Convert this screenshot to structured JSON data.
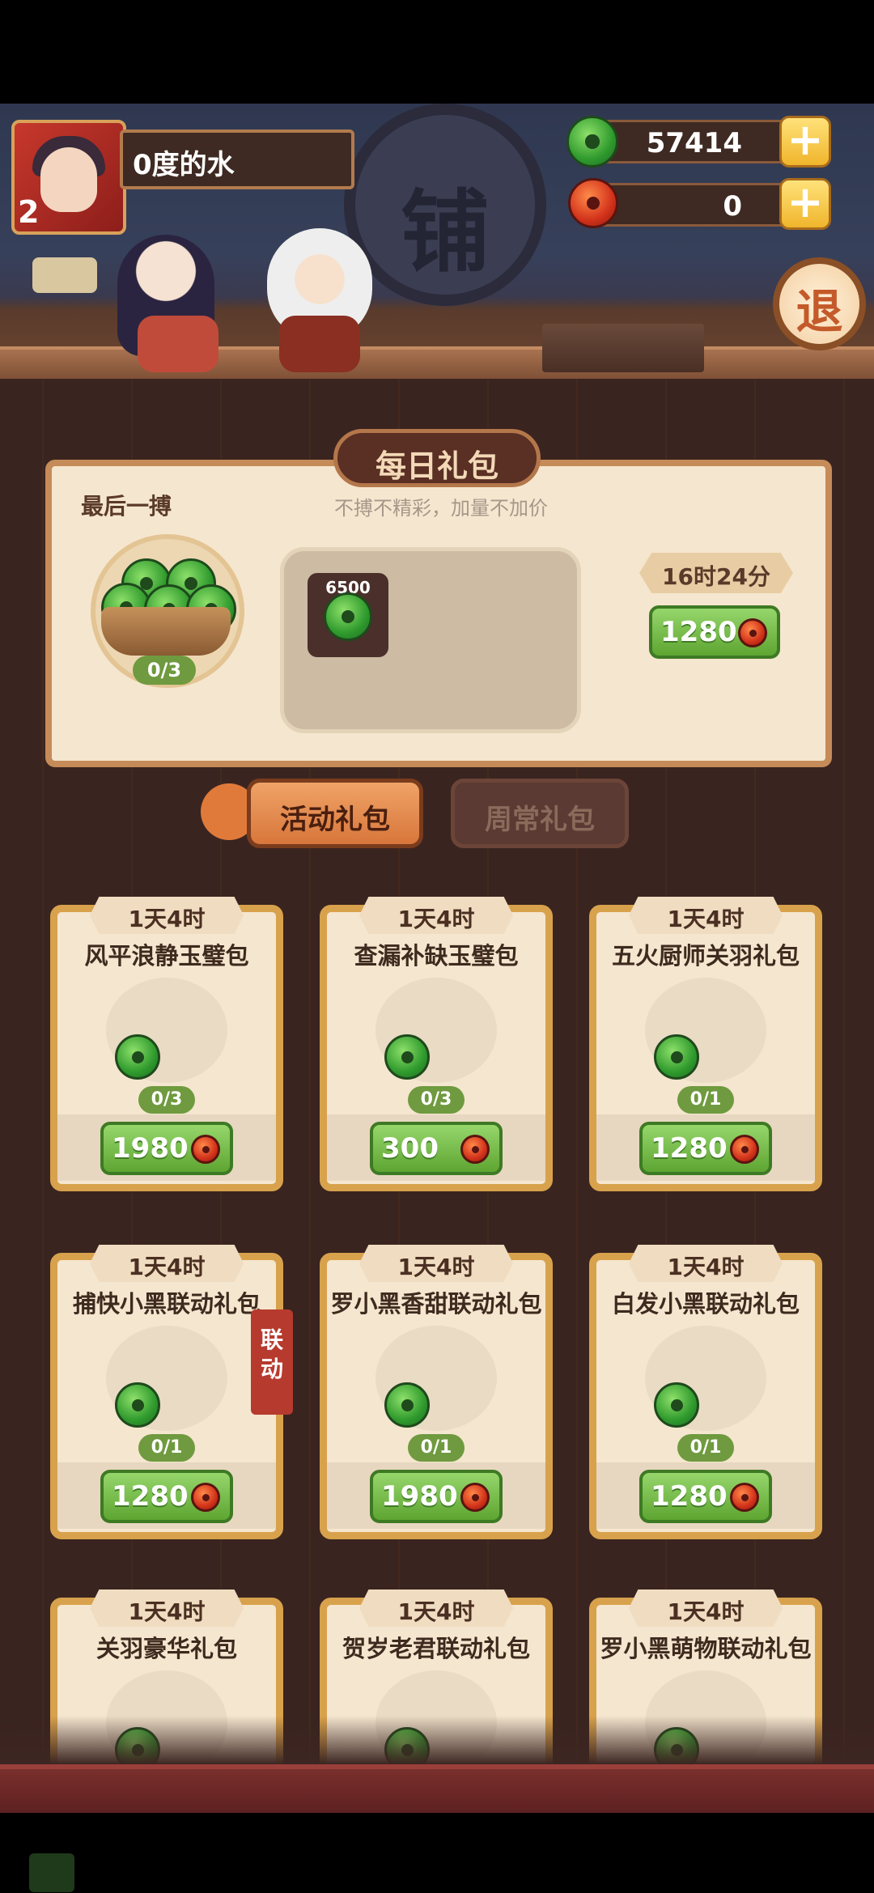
{
  "player": {
    "name": "0度的水",
    "level": "2"
  },
  "currency": {
    "jade": {
      "value": "57414",
      "icon": "jade-coin-icon",
      "color": "#5ea532"
    },
    "ruby": {
      "value": "0",
      "icon": "red-bead-icon",
      "color": "#d2321a"
    }
  },
  "shop_sign": "铺",
  "exit_label": "退",
  "daily": {
    "title": "每日礼包",
    "pack_name": "最后一搏",
    "slogan": "不搏不精彩，加量不加价",
    "count": "0/3",
    "reward_amount": "6500",
    "timer": "16时24分",
    "price": "1280"
  },
  "tabs": [
    {
      "label": "活动礼包",
      "active": true
    },
    {
      "label": "周常礼包",
      "active": false
    }
  ],
  "link_badge": "联动",
  "gifts": [
    {
      "timer": "1天4时",
      "name": "风平浪静玉璧包",
      "count": "0/3",
      "price": "1980"
    },
    {
      "timer": "1天4时",
      "name": "查漏补缺玉璧包",
      "count": "0/3",
      "price": "300"
    },
    {
      "timer": "1天4时",
      "name": "五火厨师关羽礼包",
      "count": "0/1",
      "price": "1280"
    },
    {
      "timer": "1天4时",
      "name": "捕快小黑联动礼包",
      "count": "0/1",
      "price": "1280"
    },
    {
      "timer": "1天4时",
      "name": "罗小黑香甜联动礼包",
      "count": "0/1",
      "price": "1980"
    },
    {
      "timer": "1天4时",
      "name": "白发小黑联动礼包",
      "count": "0/1",
      "price": "1280"
    },
    {
      "timer": "1天4时",
      "name": "关羽豪华礼包"
    },
    {
      "timer": "1天4时",
      "name": "贺岁老君联动礼包"
    },
    {
      "timer": "1天4时",
      "name": "罗小黑萌物联动礼包"
    }
  ]
}
